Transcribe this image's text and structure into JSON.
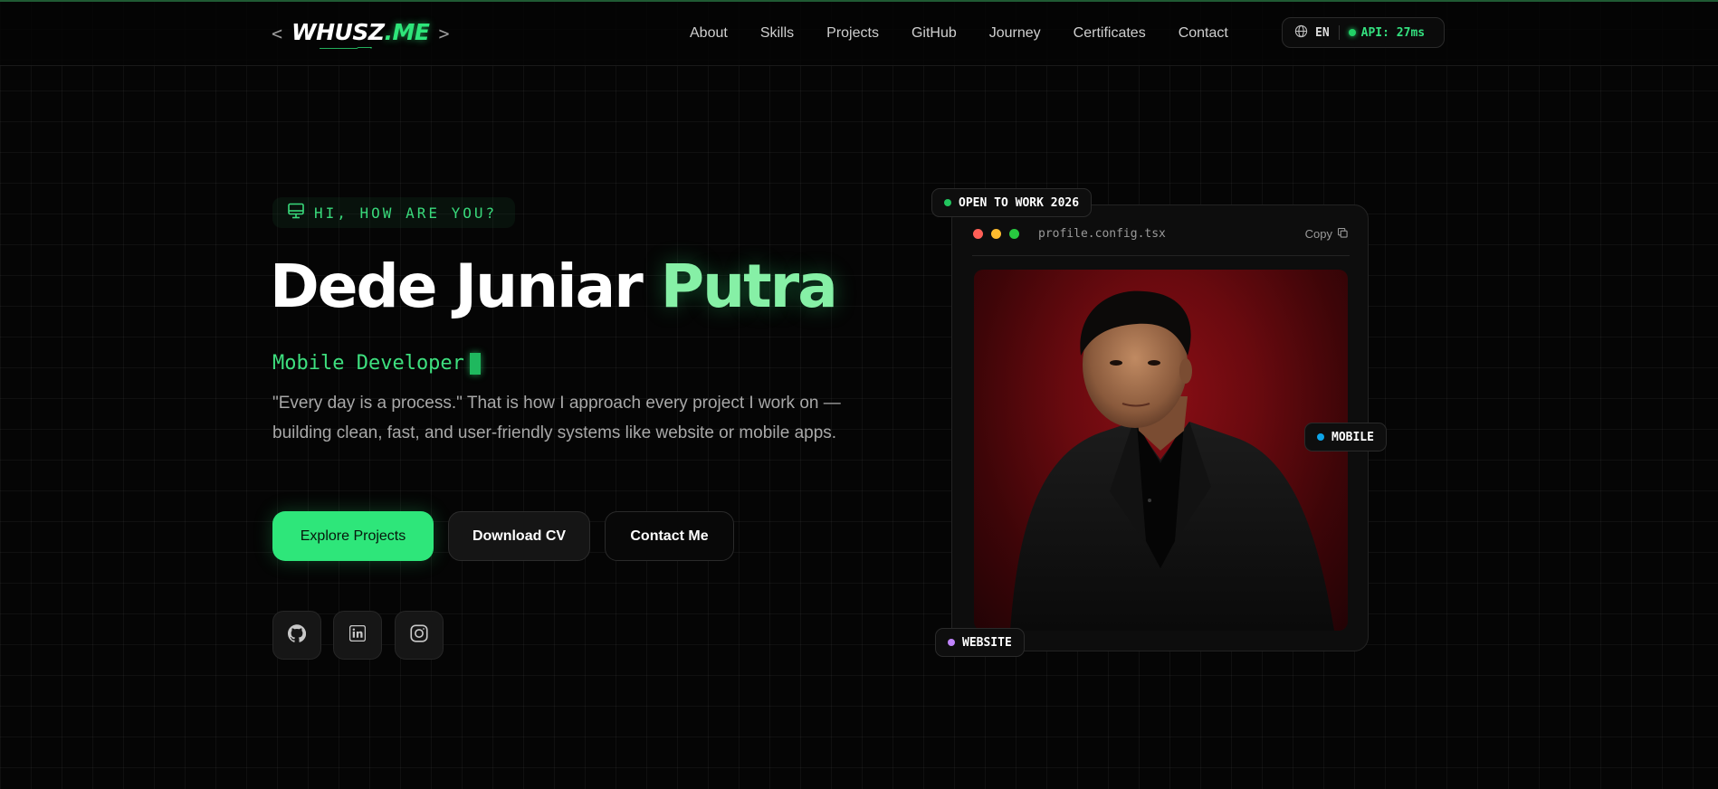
{
  "nav": {
    "logo_left_bracket": "<",
    "logo_text": "WHUSZ",
    "logo_suffix": ".ME",
    "logo_right_bracket": ">",
    "links": [
      "About",
      "Skills",
      "Projects",
      "GitHub",
      "Journey",
      "Certificates",
      "Contact"
    ],
    "language": "EN",
    "api_status": "API: 27ms"
  },
  "hero": {
    "greeting": "HI, HOW ARE YOU?",
    "name_first": "Dede Juniar",
    "name_accent": "Putra",
    "role": "Mobile Developer",
    "tagline": "\"Every day is a process.\" That is how I approach every project I work on — building clean, fast, and user-friendly systems like website or mobile apps.",
    "buttons": {
      "primary": "Explore Projects",
      "secondary": "Download CV",
      "contact": "Contact Me"
    }
  },
  "profile_card": {
    "filename": "profile.config.tsx",
    "copy_label": "Copy",
    "badge_open": "OPEN TO WORK 2026",
    "badge_mobile": "MOBILE",
    "badge_website": "WEBSITE"
  },
  "colors": {
    "accent": "#2ee67a",
    "background": "#050505",
    "photo_backdrop": "#7a0c12",
    "dot_red": "#ff5f57",
    "dot_yellow": "#febc2e",
    "dot_green": "#28c840",
    "badge_open_dot": "#22c55e",
    "badge_mobile_dot": "#0ea5e9",
    "badge_website_dot": "#c084fc"
  },
  "icons": [
    "globe-icon",
    "monitor-icon",
    "github-icon",
    "linkedin-icon",
    "instagram-icon",
    "copy-icon"
  ]
}
